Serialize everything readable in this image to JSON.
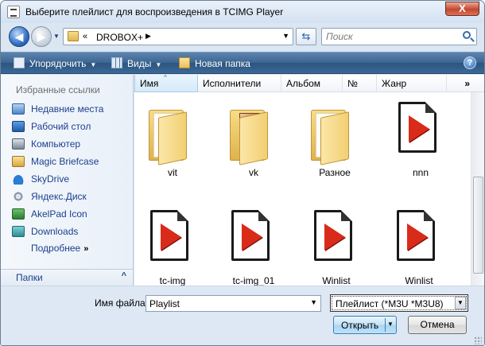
{
  "window": {
    "title": "Выберите плейлист для воспроизведения в TCIMG Player",
    "close_glyph": "X"
  },
  "navigation": {
    "back_glyph": "◀",
    "forward_glyph": "▶"
  },
  "address": {
    "chevron": "«",
    "path": "DROBOX+",
    "arrow": "▶"
  },
  "search": {
    "placeholder": "Поиск"
  },
  "toolbar": {
    "organize": "Упорядочить",
    "views": "Виды",
    "new_folder": "Новая папка",
    "help": "?"
  },
  "sidebar": {
    "header": "Избранные ссылки",
    "items": [
      {
        "label": "Недавние места",
        "icon": "recent-places-icon"
      },
      {
        "label": "Рабочий стол",
        "icon": "desktop-icon"
      },
      {
        "label": "Компьютер",
        "icon": "computer-icon"
      },
      {
        "label": "Magic Briefcase",
        "icon": "briefcase-icon"
      },
      {
        "label": "SkyDrive",
        "icon": "skydrive-icon"
      },
      {
        "label": "Яндекс.Диск",
        "icon": "yandex-disk-icon"
      },
      {
        "label": "AkelPad Icon",
        "icon": "akelpad-icon"
      },
      {
        "label": "Downloads",
        "icon": "downloads-icon"
      }
    ],
    "more": "Подробнее",
    "more_chevron": "»",
    "folders": "Папки",
    "folders_chevron": "^"
  },
  "columns": {
    "name": "Имя",
    "artists": "Исполнители",
    "album": "Альбом",
    "number": "№",
    "genre": "Жанр",
    "more": "»"
  },
  "files": [
    {
      "name": "vit",
      "type": "folder"
    },
    {
      "name": "vk",
      "type": "folder-image"
    },
    {
      "name": "Разное",
      "type": "folder"
    },
    {
      "name": "nnn",
      "type": "playlist"
    },
    {
      "name": "tc-img",
      "type": "playlist"
    },
    {
      "name": "tc-img_01",
      "type": "playlist"
    },
    {
      "name": "Winlist",
      "type": "playlist"
    },
    {
      "name": "Winlist",
      "type": "playlist"
    }
  ],
  "footer": {
    "filename_label": "Имя файла:",
    "filename_value": "Playlist",
    "filter": "Плейлист (*M3U *M3U8)",
    "open": "Открыть",
    "cancel": "Отмена"
  },
  "colors": {
    "command_bar": "#3b6592",
    "link_text": "#1c3f8f",
    "play_red": "#d92b1a"
  }
}
